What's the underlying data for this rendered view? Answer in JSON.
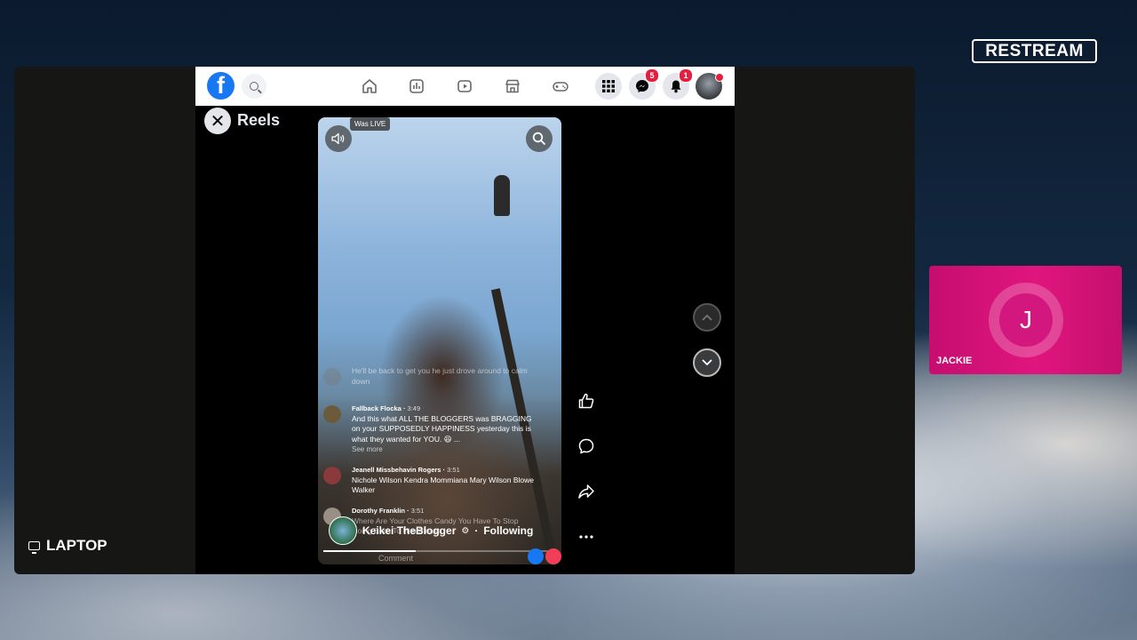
{
  "brand": {
    "logo_text": "RESTREAM"
  },
  "scene": {
    "label": "LAPTOP",
    "label_icon": "monitor-icon"
  },
  "facebook": {
    "logo_letter": "f",
    "badges": {
      "messenger": "5",
      "notifications": "1"
    },
    "reels_title": "Reels",
    "close_glyph": "✕",
    "video": {
      "status_tag": "Was LIVE",
      "comments": [
        {
          "name": "",
          "time": "",
          "text": "He'll be back to get you he just drove around to calm down",
          "see_more": ""
        },
        {
          "name": "Fallback Flocka",
          "time": "3:49",
          "text": "And this what ALL THE BLOGGERS was BRAGGING on your SUPPOSEDLY HAPPINESS yesterday this is what they wanted for YOU. 😆 ...",
          "see_more": "See more"
        },
        {
          "name": "Jeanell Missbehavin Rogers",
          "time": "3:51",
          "text": "Nichole Wilson Kendra Mommiana Mary Wilson Blowe Walker",
          "see_more": ""
        },
        {
          "name": "Dorothy Franklin",
          "time": "3:51",
          "text": "Where Are Your Clothes Candy You Have To Stop Going Back To Him Please",
          "see_more": ""
        }
      ],
      "author": {
        "name": "Keikei TheBlogger",
        "follow_state": "Following"
      },
      "comment_placeholder": "Comment",
      "progress": 0.4
    }
  },
  "participant": {
    "initial": "J",
    "name": "JACKIE"
  },
  "colors": {
    "facebook_blue": "#1877f2",
    "badge_red": "#e41e3f",
    "participant_pink": "#e0157e"
  }
}
